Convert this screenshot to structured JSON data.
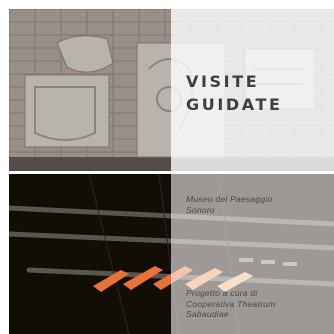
{
  "post": {
    "title_line1": "VISITE",
    "title_line2": "GUIDATE",
    "subtitle_line1": "Museo del Paesaggio",
    "subtitle_line2": "Sonoro",
    "credit_line1": "Progetto a cura di",
    "credit_line2": "Cooperativa Theatrum",
    "credit_line3": "Sabaudiae"
  },
  "colors": {
    "title": "#3d3f45",
    "overlay": "#ffffff",
    "wall": "#8d847e",
    "glow": "#e8733a"
  }
}
